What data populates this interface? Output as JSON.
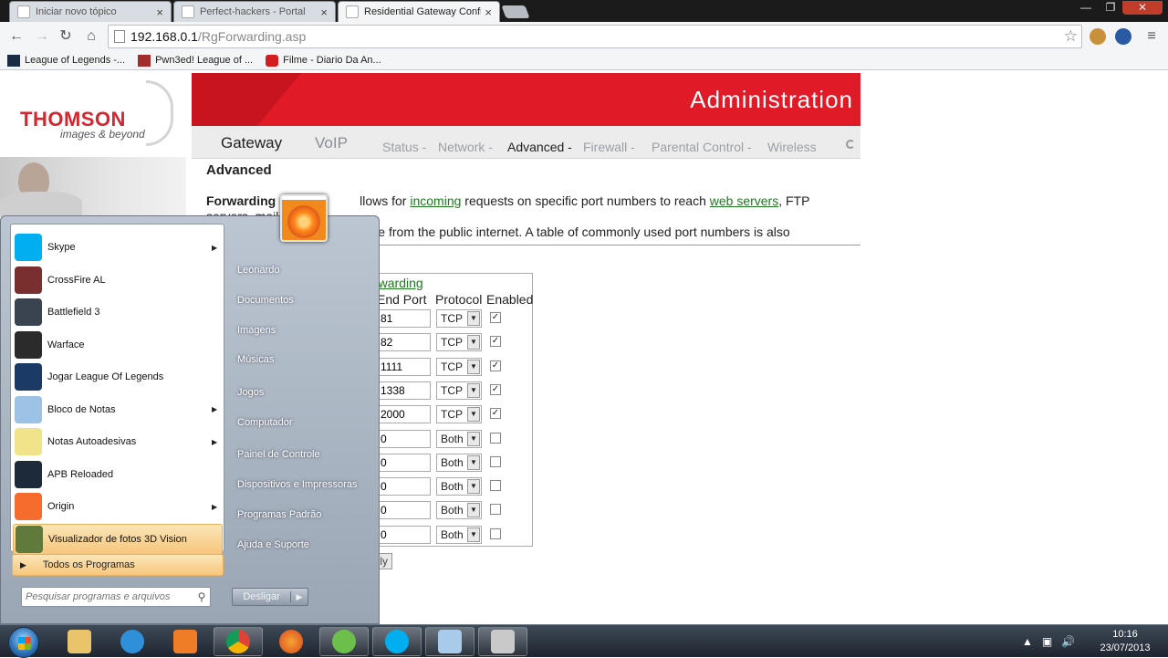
{
  "browser": {
    "tabs": [
      {
        "title": "Iniciar novo tópico",
        "close": "×"
      },
      {
        "title": "Perfect-hackers - Portal",
        "close": "×"
      },
      {
        "title": "Residential Gateway Confi",
        "close": "×"
      }
    ],
    "url_host": "192.168.0.1",
    "url_path": "/RgForwarding.asp",
    "bookmarks": [
      {
        "label": "League of Legends -..."
      },
      {
        "label": "Pwn3ed! League of ..."
      },
      {
        "label": "Filme - Diario Da An..."
      }
    ]
  },
  "router": {
    "logo": "THOMSON",
    "logo_sub": "images & beyond",
    "banner": "Administration",
    "main_tabs": [
      "Gateway",
      "VoIP"
    ],
    "sub_nav": [
      "Status -",
      "Network -",
      "Advanced -",
      "Firewall -",
      "Parental Control -",
      "Wireless"
    ],
    "heading": "Advanced",
    "para": {
      "bold": "Forwarding",
      "t1": "llows for ",
      "l1": "incoming",
      "t2": " requests on specific port numbers to reach ",
      "l2": "web servers",
      "t3": ", FTP servers, mail",
      "line2": "servers, etc. ...an be accessible from the public internet. A table of commonly used port numbers is also"
    },
    "fwd_link": "rwarding",
    "headers": {
      "end_port": "End Port",
      "protocol": "Protocol",
      "enabled": "Enabled"
    },
    "rows": [
      {
        "end": "81",
        "proto": "TCP",
        "enabled": true
      },
      {
        "end": "82",
        "proto": "TCP",
        "enabled": true
      },
      {
        "end": "1111",
        "proto": "TCP",
        "enabled": true
      },
      {
        "end": "1338",
        "proto": "TCP",
        "enabled": true
      },
      {
        "end": "2000",
        "proto": "TCP",
        "enabled": true
      },
      {
        "end": "0",
        "proto": "Both",
        "enabled": false
      },
      {
        "end": "0",
        "proto": "Both",
        "enabled": false
      },
      {
        "end": "0",
        "proto": "Both",
        "enabled": false
      },
      {
        "end": "0",
        "proto": "Both",
        "enabled": false
      },
      {
        "end": "0",
        "proto": "Both",
        "enabled": false
      }
    ],
    "apply": "Apply"
  },
  "startmenu": {
    "programs": [
      {
        "label": "Skype",
        "arrow": true,
        "color": "#00aff0"
      },
      {
        "label": "CrossFire AL",
        "arrow": false,
        "color": "#7a2f2f"
      },
      {
        "label": "Battlefield 3",
        "arrow": false,
        "color": "#3a4450"
      },
      {
        "label": "Warface",
        "arrow": false,
        "color": "#2b2b2b"
      },
      {
        "label": "Jogar League Of Legends",
        "arrow": false,
        "color": "#1b3a66"
      },
      {
        "label": "Bloco de Notas",
        "arrow": true,
        "color": "#9cc3e6"
      },
      {
        "label": "Notas Autoadesivas",
        "arrow": true,
        "color": "#f1e38a"
      },
      {
        "label": "APB Reloaded",
        "arrow": false,
        "color": "#1d2a3a"
      },
      {
        "label": "Origin",
        "arrow": true,
        "color": "#f56c2d"
      },
      {
        "label": "Visualizador de fotos 3D Vision",
        "arrow": false,
        "color": "#5f7a3a"
      }
    ],
    "all_programs": "Todos os Programas",
    "search_placeholder": "Pesquisar programas e arquivos",
    "right": [
      "Leonardo",
      "Documentos",
      "Imagens",
      "Músicas",
      "Jogos",
      "Computador",
      "Painel de Controle",
      "Dispositivos e Impressoras",
      "Programas Padrão",
      "Ajuda e Suporte"
    ],
    "shutdown": "Desligar"
  },
  "taskbar": {
    "time": "10:16",
    "date": "23/07/2013"
  }
}
